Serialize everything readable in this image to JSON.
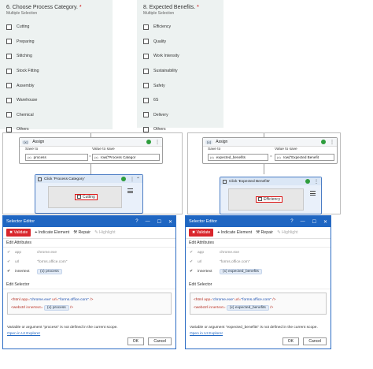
{
  "forms": [
    {
      "question": "6. Choose Process Category.",
      "required_mark": "*",
      "subtitle": "Multiple Selection",
      "options": [
        "Cutting",
        "Preparing",
        "Stitching",
        "Stock Fitting",
        "Assembly",
        "Warehouse",
        "Chemical",
        "Others"
      ]
    },
    {
      "question": "8. Expected Benefits.",
      "required_mark": "*",
      "subtitle": "Multiple Selection",
      "options": [
        "Efficiency",
        "Quality",
        "Work Intensity",
        "Sustainability",
        "Safety",
        "6S",
        "Delivery",
        "Others"
      ]
    }
  ],
  "designers": [
    {
      "assign_label": "Assign",
      "assign_badge": "(x)",
      "save_to_label": "Save to",
      "save_to_value": "process",
      "value_label": "Value to save",
      "value_value": "row(\"Process Categor",
      "click_label": "Click 'Process Category'",
      "target_text": "Cutting"
    },
    {
      "assign_label": "Assign",
      "assign_badge": "(x)",
      "save_to_label": "Save to",
      "save_to_value": "expected_benefits",
      "value_label": "Value to save",
      "value_value": "row(\"Expected Benefit",
      "click_label": "Click 'Expected Benefits'",
      "target_text": "Efficiency"
    }
  ],
  "editors": [
    {
      "title": "Selector Editor",
      "validate": "Validate",
      "indicate": "Indicate Element",
      "repair": "Repair",
      "highlight": "Highlight",
      "edit_attributes": "Edit Attributes",
      "attrs": [
        {
          "name": "app",
          "value": "chrome.exe"
        },
        {
          "name": "url",
          "value": "\"forms.office.com\""
        },
        {
          "name": "innertext",
          "value": "process"
        }
      ],
      "edit_selector": "Edit Selector",
      "sel_line1_tag": "<html",
      "sel_line1_a1": "app=",
      "sel_line1_v1": "'chrome.exe'",
      "sel_line1_a2": "url=",
      "sel_line1_v2": "\"forms.office.com\"",
      "sel_line1_end": "/>",
      "sel_line2_tag": "<webctrl",
      "sel_line2_a": "innertext=",
      "sel_line2_var": "process",
      "sel_line2_end": "/>",
      "error": "Variable or argument \"process\" is not defined in the current scope.",
      "open_link": "Open in UI Explorer",
      "ok": "OK",
      "cancel": "Cancel"
    },
    {
      "title": "Selector Editor",
      "validate": "Validate",
      "indicate": "Indicate Element",
      "repair": "Repair",
      "highlight": "Highlight",
      "edit_attributes": "Edit Attributes",
      "attrs": [
        {
          "name": "app",
          "value": "chrome.exe"
        },
        {
          "name": "url",
          "value": "\"forms.office.com\""
        },
        {
          "name": "innertext",
          "value": "expected_benefits"
        }
      ],
      "edit_selector": "Edit Selector",
      "sel_line1_tag": "<html",
      "sel_line1_a1": "app=",
      "sel_line1_v1": "'chrome.exe'",
      "sel_line1_a2": "url=",
      "sel_line1_v2": "\"forms.office.com\"",
      "sel_line1_end": "/>",
      "sel_line2_tag": "<webctrl",
      "sel_line2_a": "innertext=",
      "sel_line2_var": "expected_benefits",
      "sel_line2_end": "/>",
      "error": "Variable or argument \"expected_benefits\" is not defined in the current scope.",
      "open_link": "Open in UI Explorer",
      "ok": "OK",
      "cancel": "Cancel"
    }
  ],
  "glyphs": {
    "help": "?",
    "minimize": "—",
    "maximize": "☐",
    "close": "✕",
    "check": "✔",
    "dots": "⋮",
    "collapse": "⌃",
    "x_var": "(x)"
  }
}
